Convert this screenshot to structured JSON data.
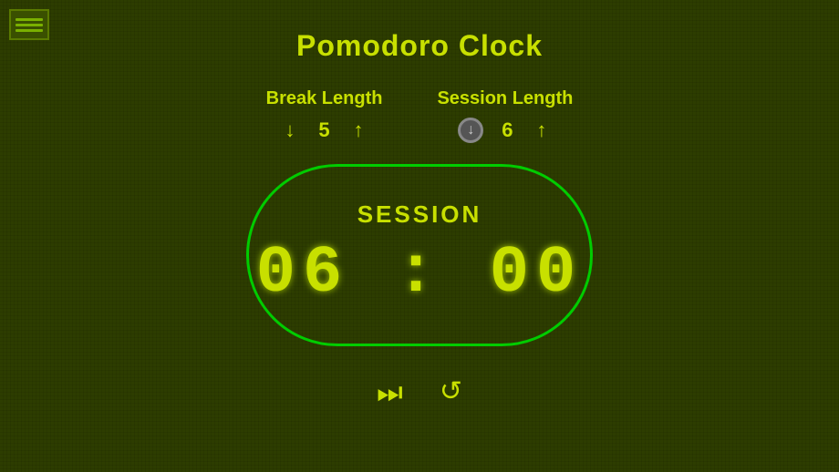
{
  "app": {
    "title": "Pomodoro Clock"
  },
  "break": {
    "label": "Break Length",
    "value": "5",
    "decrement_label": "↓",
    "increment_label": "↑"
  },
  "session": {
    "label": "Session Length",
    "value": "6",
    "increment_label": "↑"
  },
  "timer": {
    "mode": "SESSION",
    "display": "06 : 00"
  },
  "controls": {
    "play_pause_icon": "⏭",
    "reset_icon": "↺"
  }
}
